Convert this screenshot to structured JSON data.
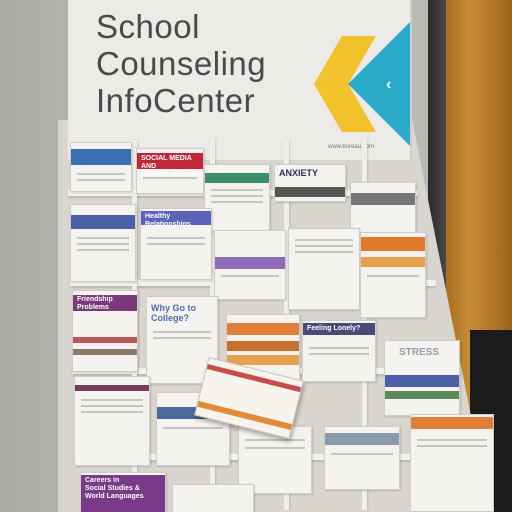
{
  "header": {
    "title": "School\nCounseling\nInfoCenter",
    "url_text": "www.bureau.com"
  },
  "colors": {
    "chevron_yellow": "#f2c22d",
    "chevron_blue": "#2aa9c9",
    "title_text": "#4a4a4a"
  },
  "pamphlets": [
    {
      "label": "",
      "color": "#3a6fb5"
    },
    {
      "label": "SOCIAL MEDIA AND\nMENTAL HEALTH",
      "color": "#c0283a"
    },
    {
      "label": "",
      "color": "#3a8f6a"
    },
    {
      "label": "ANXIETY",
      "color": "#2d2d63"
    },
    {
      "label": "",
      "color": "#555"
    },
    {
      "label": "",
      "color": "#4a5fa8"
    },
    {
      "label": "Healthy\nRelationships",
      "color": "#5b63b8"
    },
    {
      "label": "",
      "color": "#8d6db5"
    },
    {
      "label": "",
      "color": "#e07a2f"
    },
    {
      "label": "Friendship\nProblems",
      "color": "#7a3a7a"
    },
    {
      "label": "Why Go to\nCollege?",
      "color": "#4a70b0"
    },
    {
      "label": "",
      "color": "#e27d3a"
    },
    {
      "label": "Feeling Lonely?",
      "color": "#4a4a7a"
    },
    {
      "label": "STRESS",
      "color": "#4a5fa8"
    },
    {
      "label": "Careers in\nSocial Studies &\nWorld Languages",
      "color": "#7a3a8a"
    },
    {
      "label": "",
      "color": "#e27d3a"
    }
  ]
}
